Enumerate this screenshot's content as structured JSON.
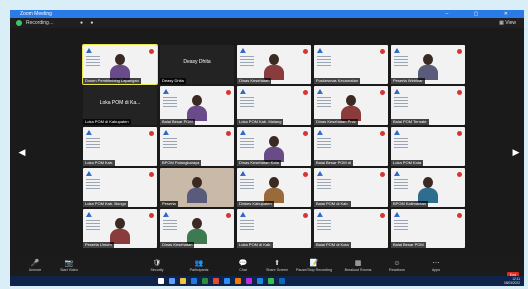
{
  "window": {
    "title": "Zoom Meeting",
    "controls": "–  ▢  ✕"
  },
  "topbar": {
    "recording": "Recording…",
    "dots": "● ●",
    "view": "▦ View"
  },
  "tiles": [
    {
      "name": "Dosen Pembimbing Lapangan",
      "kind": "person",
      "active": true
    },
    {
      "name": "Deasy Dhita",
      "kind": "dark-name",
      "center": "Deasy Dhita"
    },
    {
      "name": "Dinas Kesehatan",
      "kind": "person-slide"
    },
    {
      "name": "Puskesmas Kecamatan",
      "kind": "slide"
    },
    {
      "name": "Peserta Webinar",
      "kind": "person-slide"
    },
    {
      "name": "Loka POM di Kabupaten",
      "kind": "dark-name",
      "center": "Loka POM di Ka..."
    },
    {
      "name": "Balai Besar POM",
      "kind": "person-slide"
    },
    {
      "name": "Loka POM Kab. Malang",
      "kind": "slide"
    },
    {
      "name": "Dinas Kesehatan Prov",
      "kind": "person-slide"
    },
    {
      "name": "Balai POM Ternate",
      "kind": "slide"
    },
    {
      "name": "Loka POM Kab.",
      "kind": "slide"
    },
    {
      "name": "BPOM Palangkaraya",
      "kind": "slide"
    },
    {
      "name": "Dinas Kesehatan Kota",
      "kind": "person-slide"
    },
    {
      "name": "Balai Besar POM di",
      "kind": "slide"
    },
    {
      "name": "Loka POM Kota",
      "kind": "slide"
    },
    {
      "name": "Loka POM Kab. Bungo",
      "kind": "slide"
    },
    {
      "name": "Peserta",
      "kind": "photo"
    },
    {
      "name": "Dinkes Kabupaten",
      "kind": "person-slide"
    },
    {
      "name": "Balai POM di Kab.",
      "kind": "slide"
    },
    {
      "name": "BPOM Kalimantan",
      "kind": "person-slide"
    },
    {
      "name": "Peserta Umum",
      "kind": "person"
    },
    {
      "name": "Dinas Kesehatan",
      "kind": "person"
    },
    {
      "name": "Loka POM di Kab.",
      "kind": "slide"
    },
    {
      "name": "Balai POM di Kota",
      "kind": "slide"
    },
    {
      "name": "Balai Besar POM",
      "kind": "slide"
    }
  ],
  "nav": {
    "left": "◀",
    "right": "▶"
  },
  "toolbar": [
    {
      "icon": "🎤",
      "label": "Unmute"
    },
    {
      "icon": "📷",
      "label": "Start Video"
    },
    {
      "icon": "🛡",
      "label": "Security"
    },
    {
      "icon": "👥",
      "label": "Participants"
    },
    {
      "icon": "💬",
      "label": "Chat"
    },
    {
      "icon": "⬆",
      "label": "Share Screen"
    },
    {
      "icon": "📝",
      "label": "Pause/Stop Recording"
    },
    {
      "icon": "▦",
      "label": "Breakout Rooms"
    },
    {
      "icon": "☺",
      "label": "Reactions"
    },
    {
      "icon": "⋯",
      "label": "Apps"
    }
  ],
  "end_button": "End",
  "taskbar_colors": [
    "#ffffff",
    "#5ea0ff",
    "#f3c440",
    "#1f7ae0",
    "#2b8c3a",
    "#e54a32",
    "#2d8cff",
    "#f57c00",
    "#c42bd8",
    "#1e88e5",
    "#35c24a",
    "#0b66c2"
  ],
  "tray": {
    "time": "12:11",
    "date": "08/03/2022"
  }
}
